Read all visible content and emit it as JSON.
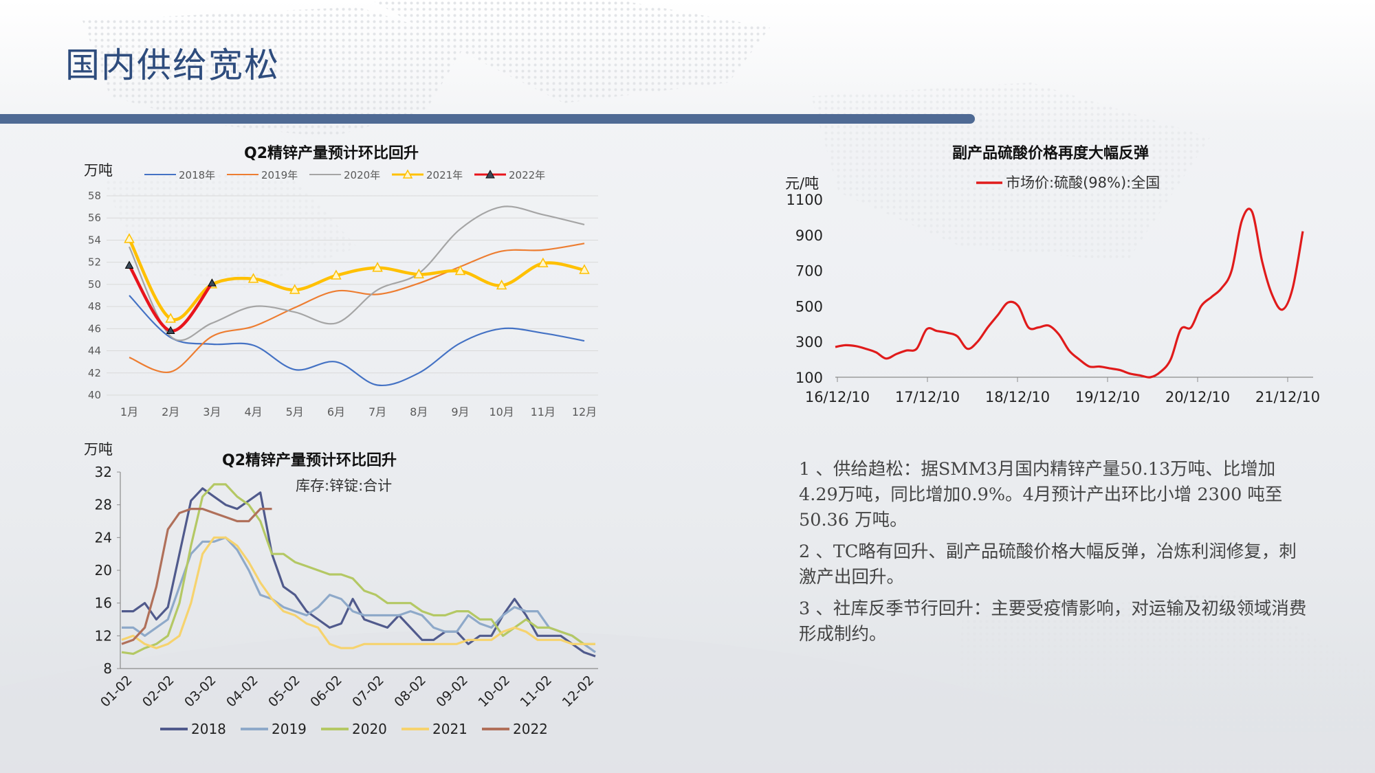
{
  "slide": {
    "title": "国内供给宽松"
  },
  "charts": {
    "top_left": {
      "title": "Q2精锌产量预计环比回升",
      "unit": "万吨"
    },
    "bottom_left": {
      "title": "Q2精锌产量预计环比回升",
      "unit": "万吨",
      "subtitle": "库存:锌锭:合计"
    },
    "right": {
      "title": "副产品硫酸价格再度大幅反弹",
      "unit": "元/吨"
    }
  },
  "paragraphs": [
    "1 、供给趋松：据SMM3月国内精锌产量50.13万吨、比增加4.29万吨，同比增加0.9%。4月预计产出环比小增 2300 吨至 50.36 万吨。",
    "2 、TC略有回升、副产品硫酸价格大幅反弹，冶炼利润修复，刺激产出回升。",
    "3 、社库反季节行回升：主要受疫情影响，对运输及初级领域消费形成制约。"
  ],
  "chart_data": [
    {
      "type": "line",
      "title": "Q2精锌产量预计环比回升",
      "ylabel": "万吨",
      "categories": [
        "1月",
        "2月",
        "3月",
        "4月",
        "5月",
        "6月",
        "7月",
        "8月",
        "9月",
        "10月",
        "11月",
        "12月"
      ],
      "ylim": [
        40,
        58
      ],
      "yticks": [
        40,
        42,
        44,
        46,
        48,
        50,
        52,
        54,
        56,
        58
      ],
      "grid": true,
      "legend": "top",
      "series": [
        {
          "name": "2018年",
          "color": "#4472c4",
          "values": [
            49.0,
            45.2,
            44.6,
            44.5,
            42.3,
            43.0,
            40.9,
            42.0,
            44.7,
            46.0,
            45.6,
            44.9
          ]
        },
        {
          "name": "2019年",
          "color": "#ed7d31",
          "values": [
            43.4,
            42.1,
            45.3,
            46.2,
            47.9,
            49.4,
            49.1,
            50.1,
            51.6,
            53.0,
            53.1,
            53.7
          ]
        },
        {
          "name": "2020年",
          "color": "#a5a5a5",
          "values": [
            53.4,
            45.3,
            46.5,
            48.0,
            47.5,
            46.5,
            49.5,
            51.0,
            55.0,
            57.0,
            56.3,
            55.4
          ]
        },
        {
          "name": "2021年",
          "color": "#ffc000",
          "markers": true,
          "values": [
            54.1,
            46.9,
            50.0,
            50.5,
            49.5,
            50.8,
            51.5,
            50.9,
            51.2,
            49.9,
            51.9,
            51.3
          ]
        },
        {
          "name": "2022年",
          "color": "#e8141c",
          "markers": true,
          "values": [
            51.7,
            45.8,
            50.1
          ]
        }
      ]
    },
    {
      "type": "line",
      "title": "Q2精锌产量预计环比回升",
      "subtitle": "库存:锌锭:合计",
      "ylabel": "万吨",
      "categories": [
        "01-02",
        "02-02",
        "03-02",
        "04-02",
        "05-02",
        "06-02",
        "07-02",
        "08-02",
        "09-02",
        "10-02",
        "11-02",
        "12-02"
      ],
      "ylim": [
        8,
        32
      ],
      "yticks": [
        8,
        12,
        16,
        20,
        24,
        28,
        32
      ],
      "legend": "bottom",
      "series": [
        {
          "name": "2018",
          "color": "#505a8c",
          "values": [
            15,
            15,
            16,
            14,
            15.5,
            22,
            28.5,
            30,
            29,
            28,
            27.5,
            28.5,
            29.5,
            22,
            18,
            17,
            15,
            14,
            13,
            13.5,
            16.5,
            14,
            13.5,
            13,
            14.5,
            13,
            11.5,
            11.5,
            12.5,
            12.5,
            11,
            12,
            12,
            14.5,
            16.5,
            14.5,
            12,
            12,
            12,
            11,
            10,
            9.5
          ]
        },
        {
          "name": "2019",
          "color": "#8ea9c9",
          "values": [
            13,
            13,
            12,
            13,
            14,
            18,
            22,
            23.5,
            23.5,
            24,
            22.5,
            20,
            17,
            16.5,
            15.5,
            15,
            14.5,
            15.5,
            17,
            16.5,
            15,
            14.5,
            14.5,
            14.5,
            14.5,
            15,
            14.5,
            13,
            12.5,
            12.5,
            14.5,
            13.5,
            13,
            14.5,
            15.5,
            15,
            15,
            13,
            12.5,
            12,
            11,
            10
          ]
        },
        {
          "name": "2020",
          "color": "#b4c864",
          "values": [
            10,
            9.8,
            10.5,
            11,
            12,
            16,
            23,
            29,
            30.5,
            30.5,
            29,
            28,
            26,
            22,
            22,
            21,
            20.5,
            20,
            19.5,
            19.5,
            19,
            17.5,
            17,
            16,
            16,
            16,
            15,
            14.5,
            14.5,
            15,
            15,
            14,
            14,
            12,
            13,
            14,
            13,
            13,
            12.5,
            12,
            11,
            11
          ]
        },
        {
          "name": "2021",
          "color": "#f6d36e",
          "values": [
            11.5,
            12,
            11,
            10.5,
            11,
            12,
            16,
            22,
            24,
            24,
            23,
            21,
            18.5,
            16.5,
            15,
            14.5,
            13.5,
            13,
            11,
            10.5,
            10.5,
            11,
            11,
            11,
            11,
            11,
            11,
            11,
            11,
            11,
            11.5,
            11.5,
            11.5,
            12.5,
            13,
            12.5,
            11.5,
            11.5,
            11.5,
            11,
            11,
            11
          ]
        },
        {
          "name": "2022",
          "color": "#b0705a",
          "values": [
            11,
            11.5,
            13,
            18,
            25,
            27,
            27.5,
            27.5,
            27,
            26.5,
            26,
            26,
            27.5,
            27.5
          ]
        }
      ]
    },
    {
      "type": "line",
      "title": "副产品硫酸价格再度大幅反弹",
      "ylabel": "元/吨",
      "categories": [
        "16/12/10",
        "17/12/10",
        "18/12/10",
        "19/12/10",
        "20/12/10",
        "21/12/10"
      ],
      "ylim": [
        100,
        1100
      ],
      "yticks": [
        100,
        300,
        500,
        700,
        900,
        1100
      ],
      "legend": "top",
      "series": [
        {
          "name": "市场价:硫酸(98%):全国",
          "color": "#e01b1b",
          "values": [
            270,
            280,
            275,
            260,
            240,
            205,
            230,
            250,
            260,
            370,
            360,
            350,
            330,
            260,
            300,
            380,
            450,
            520,
            500,
            380,
            380,
            390,
            340,
            250,
            200,
            160,
            160,
            150,
            140,
            120,
            110,
            100,
            130,
            200,
            370,
            380,
            500,
            550,
            600,
            700,
            980,
            1030,
            750,
            560,
            480,
            600,
            920
          ]
        }
      ]
    }
  ]
}
